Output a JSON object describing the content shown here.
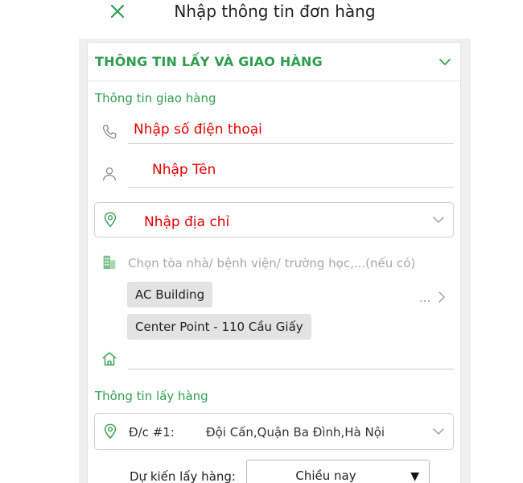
{
  "header": {
    "title": "Nhập thông tin đơn hàng",
    "close_icon": "close-icon"
  },
  "section": {
    "title": "THÔNG TIN LẤY VÀ GIAO HÀNG"
  },
  "delivery": {
    "title": "Thông tin giao hàng",
    "phone_hint": "Nhập số điện thoại",
    "name_hint": "Nhập Tên",
    "address_hint": "Nhập địa chỉ",
    "building_placeholder": "Chọn tòa nhà/ bệnh viện/ trường học,...(nếu có)",
    "suggestions": [
      "AC Building",
      "Center Point - 110 Cầu Giấy"
    ],
    "more_label": "..."
  },
  "pickup": {
    "title": "Thông tin lấy hàng",
    "address_label": "Đ/c #1:",
    "address_value": "Đội Cấn,Quận Ba Đình,Hà Nội",
    "expected_label": "Dự kiến lấy hàng:",
    "expected_value": "Chiều nay",
    "dropdown_glyph": "▼"
  },
  "colors": {
    "accent_green": "#2f9e4f",
    "hint_red": "#e60000"
  }
}
